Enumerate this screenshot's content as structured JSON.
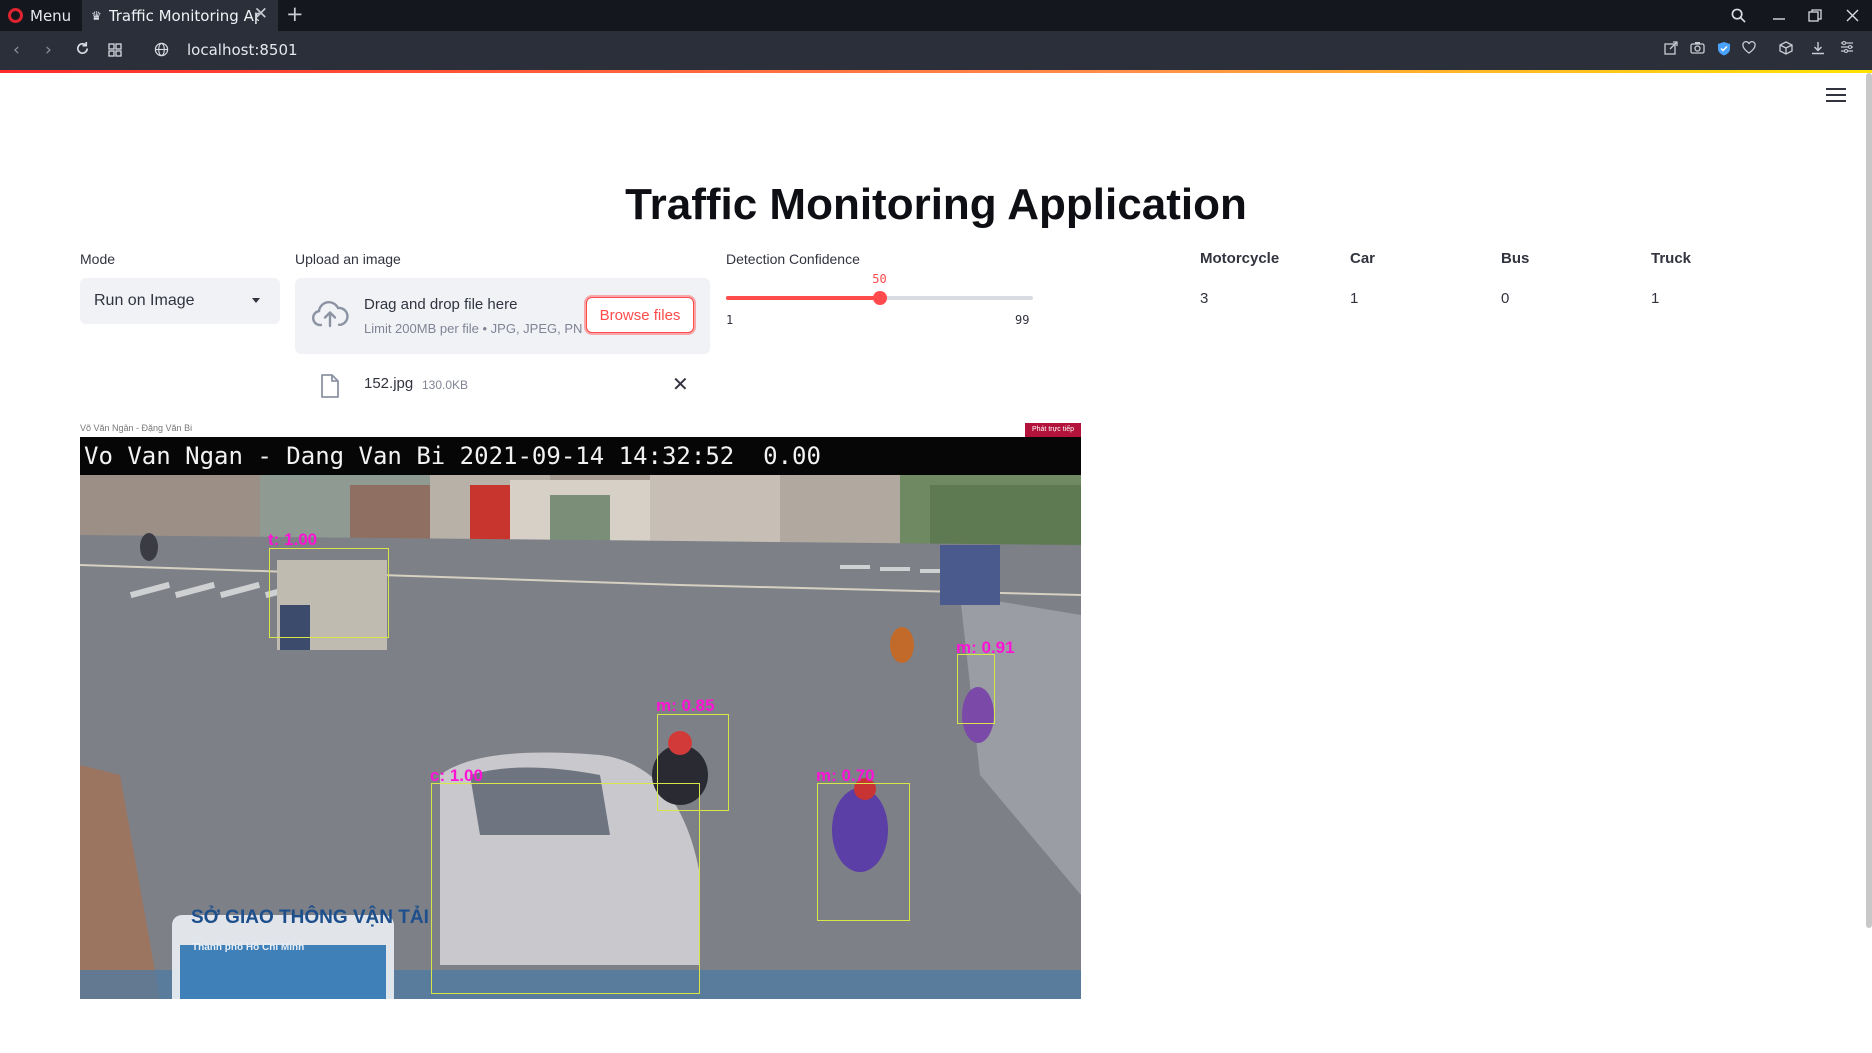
{
  "browser": {
    "menu_label": "Menu",
    "tab_title": "Traffic Monitoring Application",
    "url": "localhost:8501"
  },
  "page": {
    "title": "Traffic Monitoring Application"
  },
  "mode": {
    "label": "Mode",
    "selected": "Run on Image"
  },
  "upload": {
    "label": "Upload an image",
    "drop_text": "Drag and drop file here",
    "limit_text": "Limit 200MB per file • JPG, JPEG, PNG",
    "browse_label": "Browse files",
    "file_name": "152.jpg",
    "file_size": "130.0KB"
  },
  "confidence": {
    "label": "Detection Confidence",
    "value": 50,
    "value_text": "50",
    "min": 1,
    "max": 99,
    "min_text": "1",
    "max_text": "99",
    "accent": "#ff4b4b"
  },
  "stats": [
    {
      "name": "Motorcycle",
      "count": "3"
    },
    {
      "name": "Car",
      "count": "1"
    },
    {
      "name": "Bus",
      "count": "0"
    },
    {
      "name": "Truck",
      "count": "1"
    }
  ],
  "result_image": {
    "caption_small": "Võ Văn Ngân - Đặng Văn Bi",
    "live_badge": "Phát trực tiếp",
    "osd_text": "Vo Van Ngan - Dang Van Bi 2021-09-14 14:32:52  0.00",
    "sign_title": "SỞ GIAO THÔNG VẬN TẢI",
    "sign_sub": "Thành phố Hồ Chí Minh",
    "detections": [
      {
        "label": "t: 1.00"
      },
      {
        "label": "m: 0.85"
      },
      {
        "label": "c: 1.00"
      },
      {
        "label": "m: 0.70"
      },
      {
        "label": "m: 0.91"
      }
    ]
  }
}
